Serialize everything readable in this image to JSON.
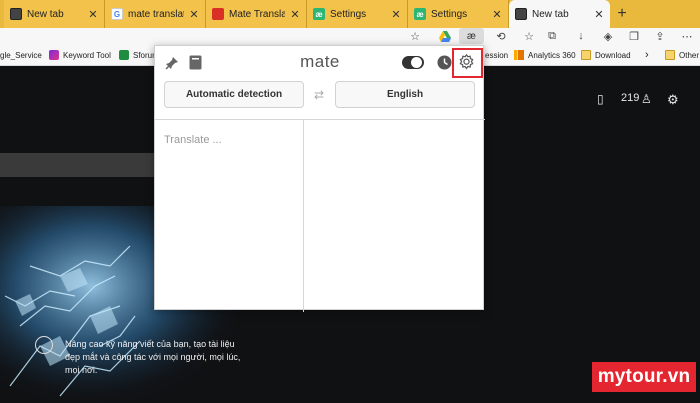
{
  "browser": {
    "tabs": [
      {
        "title": "New tab",
        "favicon": "newtab-icon",
        "color": "#444444"
      },
      {
        "title": "mate translate - Ti",
        "favicon": "google-icon",
        "color": "#4285f4"
      },
      {
        "title": "Mate Translate – tr",
        "favicon": "chrome-store-icon",
        "color": "#d93025"
      },
      {
        "title": "Settings",
        "favicon": "mate-icon",
        "color": "#2bb673"
      },
      {
        "title": "Settings",
        "favicon": "mate-icon",
        "color": "#2bb673"
      },
      {
        "title": "New tab",
        "favicon": "newtab-icon",
        "color": "#444444",
        "active": true
      }
    ],
    "new_tab_label": "+",
    "extension_label": "æ"
  },
  "bookmarks": [
    {
      "label": "gle_Service",
      "icon": "folder-icon"
    },
    {
      "label": "Keyword Tool",
      "icon": "keyword-icon"
    },
    {
      "label": "Sforum",
      "icon": "sforum-icon"
    },
    {
      "label": "ession",
      "icon": "none"
    },
    {
      "label": "Analytics 360",
      "icon": "analytics-icon"
    },
    {
      "label": "Download",
      "icon": "folder-icon"
    },
    {
      "label": "Other",
      "icon": "folder-icon"
    }
  ],
  "page": {
    "count": "219",
    "promo": "Nâng cao kỹ năng viết của bạn, tạo tài liệu đẹp mắt và công tác với mọi người, mọi lúc, mọi nơi.",
    "brand": "mytour.vn"
  },
  "mate": {
    "title": "mate",
    "source_language": "Automatic detection",
    "target_language": "English",
    "input_placeholder": "Translate ...",
    "swap_icon": "swap-icon",
    "highlight_color": "#e3262f"
  }
}
